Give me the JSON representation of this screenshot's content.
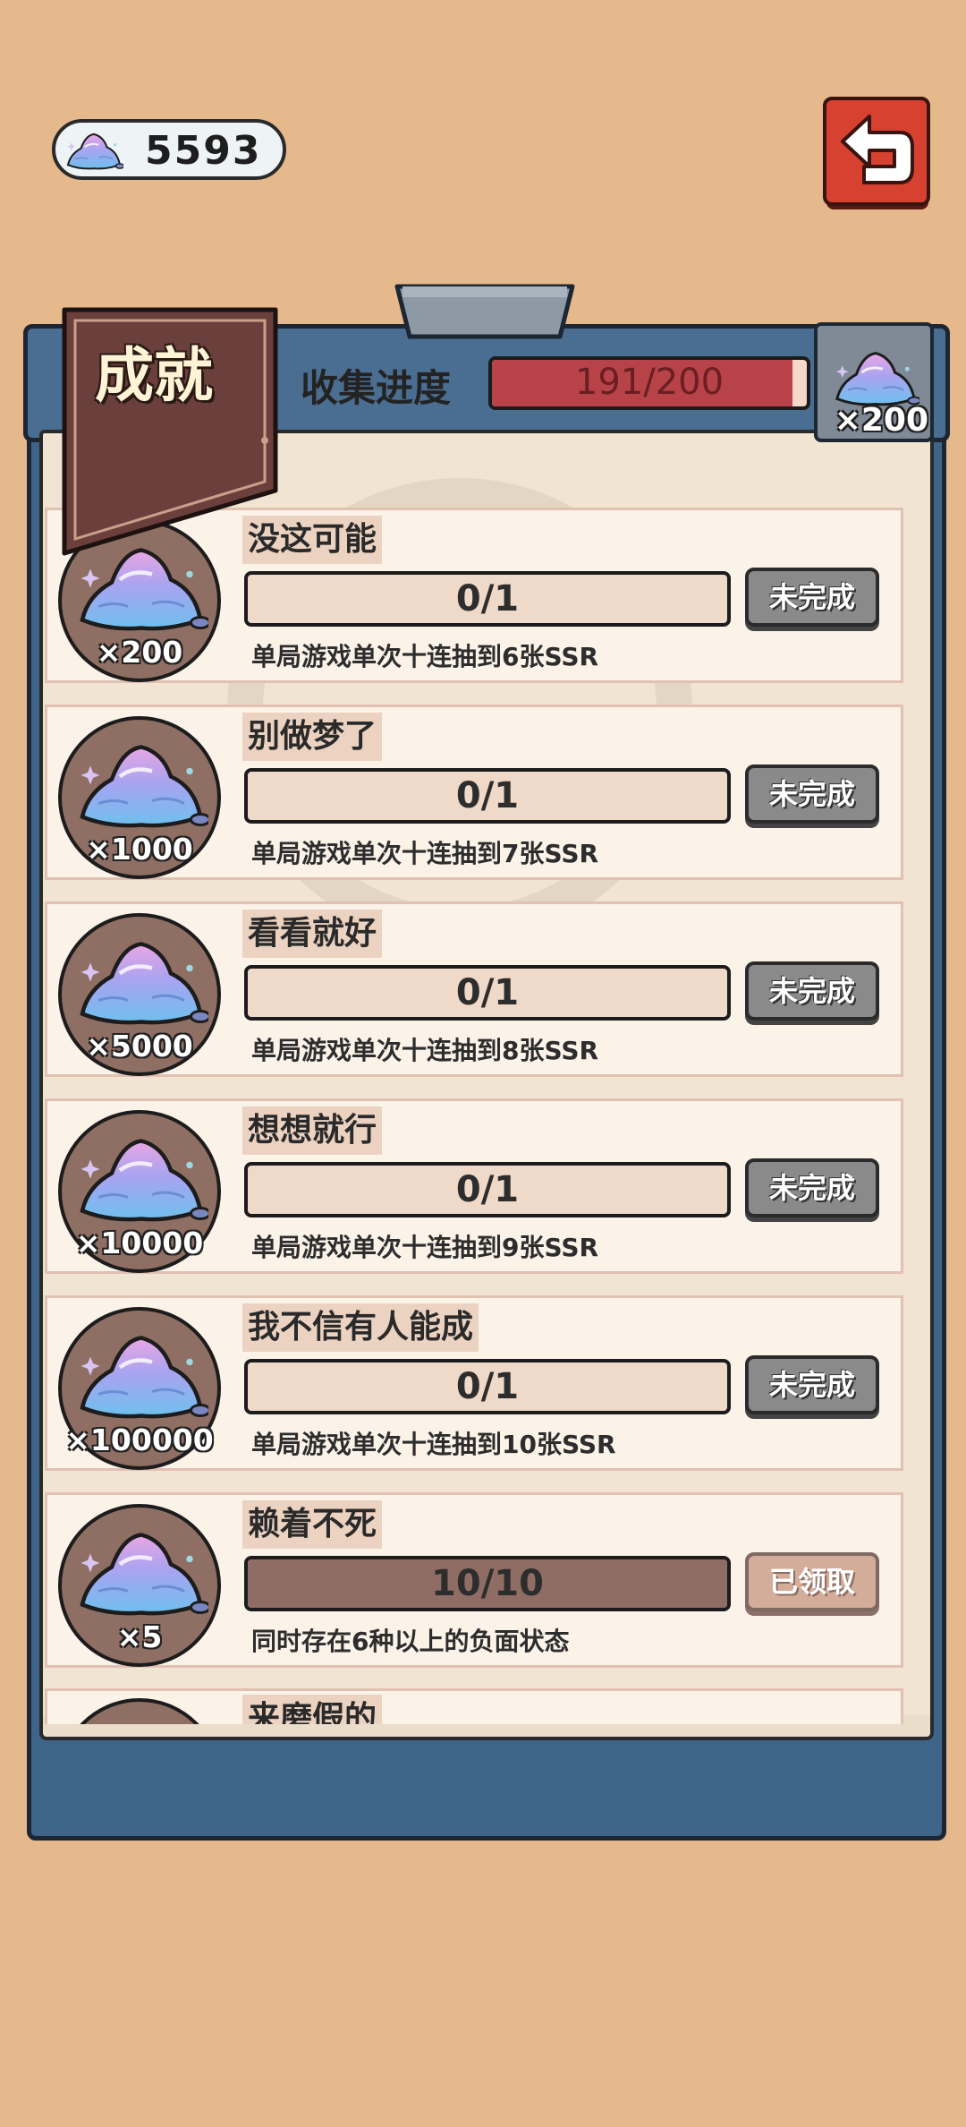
{
  "currency": {
    "icon": "crystal-icon",
    "value": "5593"
  },
  "back_button": {
    "icon": "back-arrow-icon"
  },
  "banner": {
    "title": "成就"
  },
  "progress": {
    "label": "收集进度",
    "text": "191/200",
    "fraction": 0.955,
    "reward_icon": "crystal-icon",
    "reward_qty": "×200"
  },
  "achievements": [
    {
      "title": "没这可能",
      "reward": "×200",
      "progress": "0/1",
      "fraction": 0,
      "desc": "单局游戏单次十连抽到6张SSR",
      "status": "未完成"
    },
    {
      "title": "别做梦了",
      "reward": "×1000",
      "progress": "0/1",
      "fraction": 0,
      "desc": "单局游戏单次十连抽到7张SSR",
      "status": "未完成"
    },
    {
      "title": "看看就好",
      "reward": "×5000",
      "progress": "0/1",
      "fraction": 0,
      "desc": "单局游戏单次十连抽到8张SSR",
      "status": "未完成"
    },
    {
      "title": "想想就行",
      "reward": "×10000",
      "progress": "0/1",
      "fraction": 0,
      "desc": "单局游戏单次十连抽到9张SSR",
      "status": "未完成"
    },
    {
      "title": "我不信有人能成",
      "reward": "×100000",
      "progress": "0/1",
      "fraction": 0,
      "desc": "单局游戏单次十连抽到10张SSR",
      "status": "未完成"
    },
    {
      "title": "赖着不死",
      "reward": "×5",
      "progress": "10/10",
      "fraction": 1,
      "desc": "同时存在6种以上的负面状态",
      "status": "已领取"
    }
  ],
  "partial_item": {
    "title": "来磨假的"
  },
  "colors": {
    "background": "#e5b98c",
    "board": "#3f6489",
    "progress_fill": "#b74349",
    "complete_fill": "#8f6d65",
    "button_pending": "#8a8a8a",
    "button_claimed": "#d4ac9a"
  }
}
